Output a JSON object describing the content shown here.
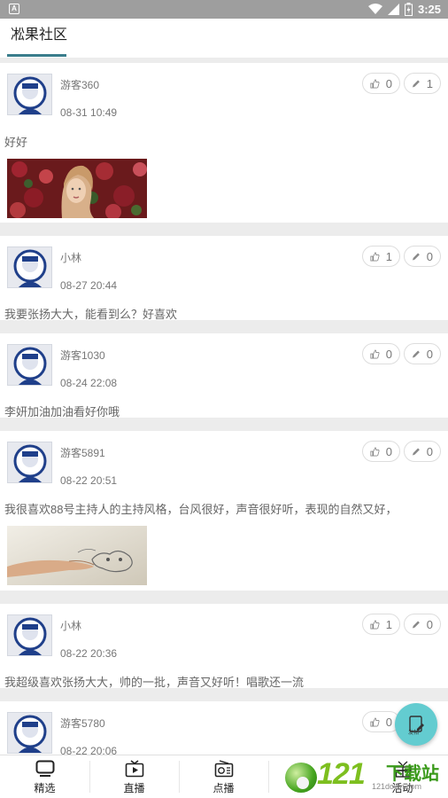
{
  "status": {
    "time": "3:25",
    "left_icon": "notification-a-icon"
  },
  "header": {
    "title": "凇果社区"
  },
  "posts": [
    {
      "user": "游客360",
      "time": "08-31  10:49",
      "likes": "0",
      "comments": "1",
      "text": "好好",
      "image": "portrait-flowers"
    },
    {
      "user": "小林",
      "time": "08-27  20:44",
      "likes": "1",
      "comments": "0",
      "text": "我要张扬大大，能看到么？好喜欢",
      "image": ""
    },
    {
      "user": "游客1030",
      "time": "08-24  22:08",
      "likes": "0",
      "comments": "0",
      "text": "李妍加油加油看好你哦",
      "image": ""
    },
    {
      "user": "游客5891",
      "time": "08-22  20:51",
      "likes": "0",
      "comments": "0",
      "text": "我很喜欢88号主持人的主持风格，台风很好，声音很好听，表现的自然又好，",
      "image": "hand-sketch"
    },
    {
      "user": "小林",
      "time": "08-22  20:36",
      "likes": "1",
      "comments": "0",
      "text": "我超级喜欢张扬大大，帅的一批，声音又好听！唱歌还一流",
      "image": ""
    },
    {
      "user": "游客5780",
      "time": "08-22  20:06",
      "likes": "0",
      "comments": "0",
      "text": "",
      "image": ""
    }
  ],
  "fab": {
    "label": "发帖",
    "icon": "edit-document-icon"
  },
  "nav": [
    {
      "label": "精选",
      "icon": "tv-icon"
    },
    {
      "label": "直播",
      "icon": "live-play-icon"
    },
    {
      "label": "点播",
      "icon": "radio-icon"
    },
    {
      "label": "",
      "icon": ""
    },
    {
      "label": "活动",
      "icon": "gift-icon"
    }
  ],
  "watermark": {
    "number": "121",
    "text": "下载站",
    "url": "121down.com"
  },
  "colors": {
    "accent": "#3a7d8c",
    "fab": "#63ccd0",
    "status_bar": "#9e9e9e"
  }
}
